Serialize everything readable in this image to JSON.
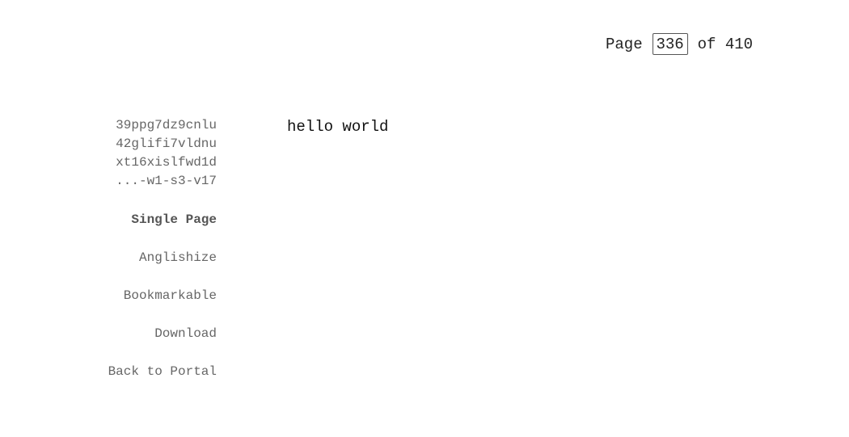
{
  "pager": {
    "prefix": "Page",
    "current_page": "336",
    "suffix": "of 410"
  },
  "sidebar": {
    "id_lines": [
      "39ppg7dz9cnlu",
      "42glifi7vldnu",
      "xt16xislfwd1d",
      "...-w1-s3-v17"
    ],
    "links": [
      {
        "label": "Single Page",
        "active": true
      },
      {
        "label": "Anglishize",
        "active": false
      },
      {
        "label": "Bookmarkable",
        "active": false
      },
      {
        "label": "Download",
        "active": false
      },
      {
        "label": "Back to Portal",
        "active": false
      }
    ]
  },
  "content": {
    "text": "hello world"
  }
}
